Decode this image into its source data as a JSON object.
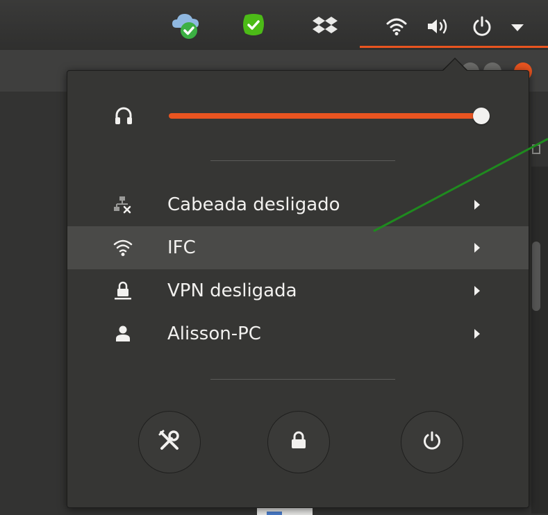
{
  "colors": {
    "accent": "#e95420",
    "menu_bg": "#363634",
    "text": "#f2f1ef",
    "annotation": "#1f8a1f"
  },
  "tray": {
    "icons": [
      "cloud-sync-icon",
      "green-check-icon",
      "dropbox-icon",
      "wifi-icon",
      "speaker-icon",
      "power-icon",
      "dropdown-arrow-icon"
    ]
  },
  "volume": {
    "icon": "headphones-icon",
    "level": 1.0
  },
  "menu": {
    "items": [
      {
        "label": "Cabeada desligado",
        "icon": "wired-network-disconnected-icon"
      },
      {
        "label": "IFC",
        "icon": "wifi-icon"
      },
      {
        "label": "VPN desligada",
        "icon": "vpn-lock-icon"
      },
      {
        "label": "Alisson-PC",
        "icon": "user-icon"
      }
    ],
    "buttons": [
      {
        "icon": "settings-tools-icon"
      },
      {
        "icon": "lock-icon"
      },
      {
        "icon": "power-icon"
      }
    ]
  }
}
